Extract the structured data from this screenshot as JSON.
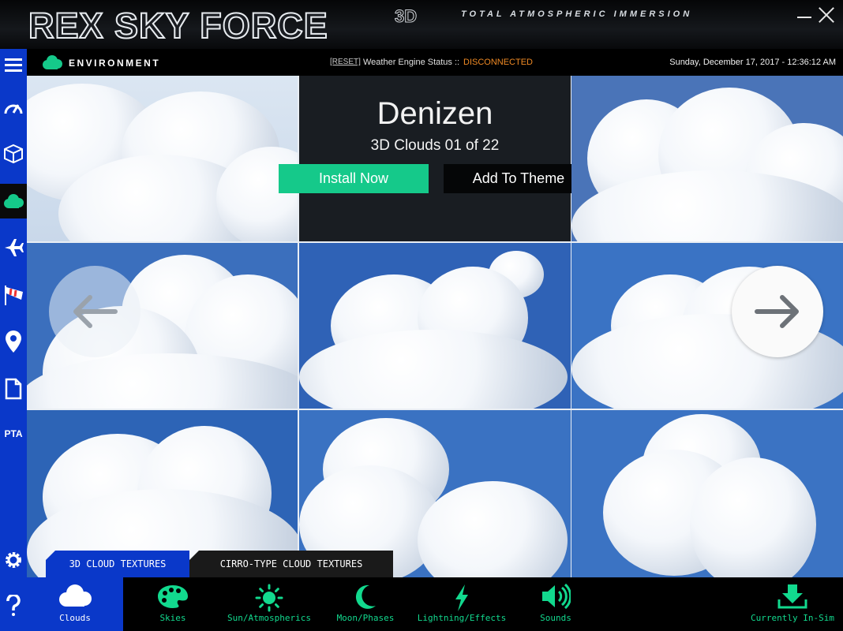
{
  "app": {
    "logo": "REX SKY FORCE",
    "logo_suffix": "3D",
    "tagline": "TOTAL ATMOSPHERIC IMMERSION"
  },
  "sidebar": {
    "items": [
      {
        "name": "menu",
        "icon": "hamburger-icon"
      },
      {
        "name": "dashboard",
        "icon": "gauge-icon"
      },
      {
        "name": "3d-objects",
        "icon": "cube-icon"
      },
      {
        "name": "environment",
        "icon": "cloud-icon",
        "active": true
      },
      {
        "name": "flight",
        "icon": "airplane-icon"
      },
      {
        "name": "wind",
        "icon": "windsock-icon"
      },
      {
        "name": "location",
        "icon": "map-pin-icon"
      },
      {
        "name": "documents",
        "icon": "document-icon"
      },
      {
        "name": "pta",
        "label": "PTA"
      },
      {
        "name": "settings",
        "icon": "gear-icon"
      },
      {
        "name": "help",
        "icon": "question-icon"
      }
    ]
  },
  "header": {
    "section": "ENVIRONMENT",
    "reset": "[RESET]",
    "status_label": "Weather Engine Status ::",
    "status_value": "DISCONNECTED",
    "datetime": "Sunday, December 17, 2017 - 12:36:12 AM"
  },
  "info": {
    "name": "Denizen",
    "counter": "3D Clouds 01 of 22",
    "install": "Install Now",
    "add_theme": "Add To Theme"
  },
  "gallery": {
    "tile_count": 8,
    "prev_icon": "arrow-left-icon",
    "next_icon": "arrow-right-icon"
  },
  "tabs": [
    {
      "label": "3D CLOUD TEXTURES",
      "active": true
    },
    {
      "label": "CIRRO-TYPE CLOUD TEXTURES",
      "active": false
    }
  ],
  "bottom": {
    "items": [
      {
        "label": "Clouds",
        "icon": "cloud-icon",
        "active": true
      },
      {
        "label": "Skies",
        "icon": "palette-icon"
      },
      {
        "label": "Sun/Atmospherics",
        "icon": "sun-icon"
      },
      {
        "label": "Moon/Phases",
        "icon": "moon-icon"
      },
      {
        "label": "Lightning/Effects",
        "icon": "lightning-icon"
      },
      {
        "label": "Sounds",
        "icon": "speaker-icon"
      },
      {
        "label": "Currently In-Sim",
        "icon": "download-icon"
      }
    ]
  },
  "colors": {
    "accent_blue": "#0a38c9",
    "accent_green": "#15c98a",
    "status_orange": "#f08a24",
    "panel_dark": "#191d22"
  }
}
